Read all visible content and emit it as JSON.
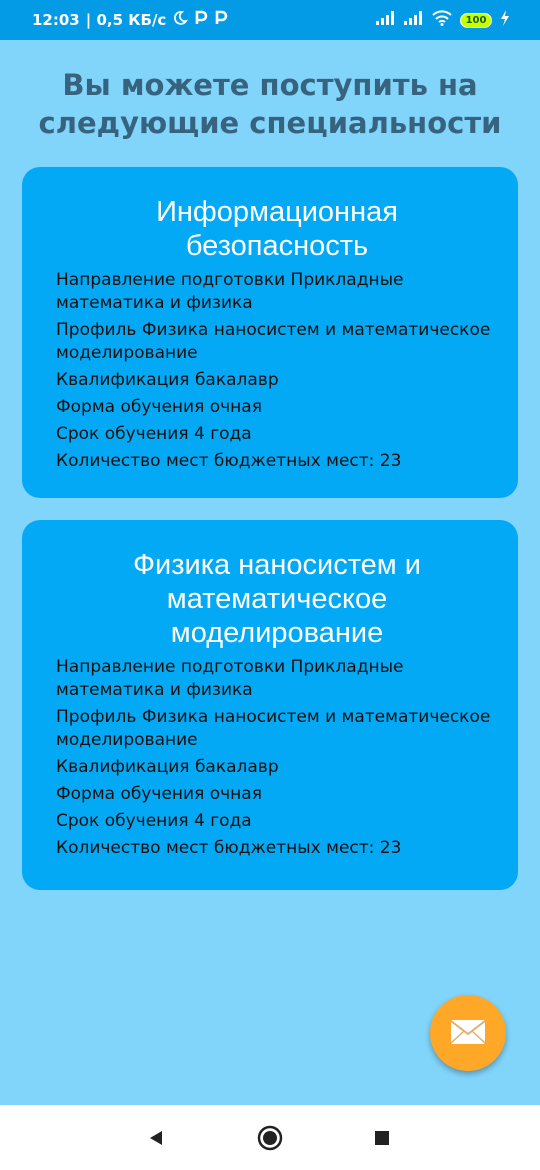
{
  "status_bar": {
    "time": "12:03",
    "speed": "| 0,5 КБ/с",
    "battery": "100",
    "icons": [
      "moon-icon",
      "p-app-icon",
      "p-app-icon",
      "signal-icon",
      "signal-icon",
      "wifi-icon",
      "battery-icon",
      "charging-icon"
    ]
  },
  "page": {
    "title_line1": "Вы можете поступить на",
    "title_line2": "следующие специальности"
  },
  "cards": [
    {
      "title": "Информационная безопасность",
      "direction": "Направление подготовки Прикладные математика и физика",
      "profile": "Профиль Физика наносистем и математическое моделирование",
      "qualification": "Квалификация бакалавр",
      "form": "Форма обучения очная",
      "duration": "Срок обучения 4 года",
      "places": "Количество мест бюджетных мест: 23"
    },
    {
      "title": "Физика наносистем и математическое моделирование",
      "direction": "Направление подготовки Прикладные математика и физика",
      "profile": "Профиль Физика наносистем и математическое моделирование",
      "qualification": "Квалификация бакалавр",
      "form": "Форма обучения очная",
      "duration": "Срок обучения 4 года",
      "places": "Количество мест бюджетных мест: 23"
    }
  ],
  "fab": {
    "icon": "mail-icon",
    "color": "#ffa726"
  },
  "nav": {
    "icons": [
      "back-icon",
      "home-icon",
      "recents-icon"
    ]
  },
  "colors": {
    "background": "#81d4fa",
    "status_bar": "#039be5",
    "card": "#03a9f4",
    "title_text": "#37637f"
  }
}
